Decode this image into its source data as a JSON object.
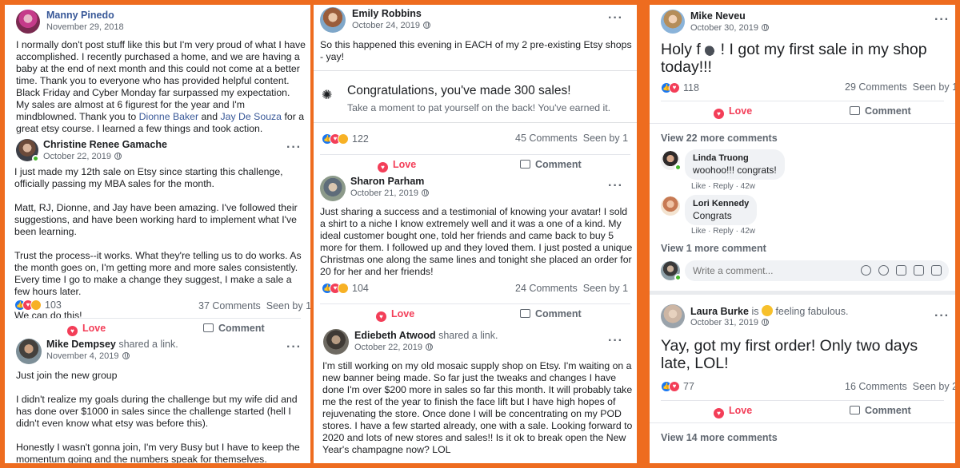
{
  "posts": {
    "manny": {
      "name": "Manny Pinedo",
      "date": "November 29, 2018",
      "text_before_link1": "I normally don't post stuff like this but I'm very proud of what I have accomplished. I recently purchased a home, and we are having a baby at the end of next month and this could not come at a better time. Thank you to everyone who has provided helpful content. Black Friday and Cyber Monday far surpassed my expectation. My sales are almost at 6 figurest for the year and I'm mindblowned. Thank you to ",
      "link1": "Dionne Baker",
      "text_between": " and ",
      "link2": "Jay De Souza",
      "text_after": " for a great etsy course. I learned a few things and took action."
    },
    "christine": {
      "name": "Christine Renee Gamache",
      "date": "October 22, 2019",
      "text": "I just made my 12th sale on Etsy since starting this challenge, officially passing my MBA sales for the month.\n\nMatt, RJ, Dionne, and Jay have been amazing.  I've followed their suggestions, and have been working hard to implement what I've been learning.\n\nTrust the process--it works.  What they're telling us to do works.  As the month goes on, I'm getting more and more sales consistently. Every time I go to make a change they suggest, I make a sale a few hours later.\n\nWe can do this!",
      "reactions": "103",
      "comments": "37 Comments",
      "seen": "Seen by 1",
      "love_label": "Love",
      "comment_label": "Comment"
    },
    "mike_d": {
      "name": "Mike Dempsey",
      "shared": "shared a link.",
      "date": "November 4, 2019",
      "text": "Just join the new group\n\nI didn't realize my goals during the challenge but my wife did and has done over $1000 in sales since the challenge started (hell I didn't even know what etsy was before this).\n\nHonestly I wasn't gonna join, I'm very Busy but I have to keep the momentum going and the numbers speak for themselves.\n\n.Next level folks, that is what I am seeking"
    },
    "emily": {
      "name": "Emily Robbins",
      "date": "October 24, 2019",
      "text": "So this happened this evening in EACH of my 2 pre-existing Etsy shops - yay!",
      "card_title": "Congratulations, you've made 300 sales!",
      "card_sub": "Take a moment to pat yourself on the back! You've earned it.",
      "reactions": "122",
      "comments": "45 Comments",
      "seen": "Seen by 1",
      "love_label": "Love",
      "comment_label": "Comment"
    },
    "sharon": {
      "name": "Sharon Parham",
      "date": "October 21, 2019",
      "text": "Just sharing a success and a testimonial of knowing your avatar! I sold a shirt to a niche I know extremely well and it was a one of a kind. My ideal customer bought one, told her friends and came back to buy 5 more for them. I followed up and they loved them. I just posted a unique Christmas one along the same lines and tonight she placed an order for 20 for her and her friends!",
      "reactions": "104",
      "comments": "24 Comments",
      "seen": "Seen by 1",
      "love_label": "Love",
      "comment_label": "Comment"
    },
    "ediebeth": {
      "name": "Ediebeth Atwood",
      "shared": "shared a link.",
      "date": "October 22, 2019",
      "text": "I'm still working on my old mosaic supply shop on Etsy.  I'm waiting on a new banner being made.  So far just the tweaks and changes I have done I'm over $200 more in sales so far this month.  It will probably take me the rest of the year to finish the face lift but I have high hopes of rejuvenating the store. Once done I will be concentrating on my POD stores. I have a few started already, one with a sale.  Looking forward to 2020 and lots of new stores and sales!!  Is it ok to break open the New Year's champagne now?  LOL"
    },
    "mike_n": {
      "name": "Mike Neveu",
      "date": "October 30, 2019",
      "text_before": "Holy f ",
      "text_after": " ! I got my first sale in my shop today!!!",
      "emoji": "bomb-emoji",
      "reactions": "118",
      "comments": "29 Comments",
      "seen": "Seen by 1",
      "love_label": "Love",
      "comment_label": "Comment",
      "view_more": "View 22 more comments",
      "comment1_name": "Linda Truong",
      "comment1_text": "woohoo!!! congrats!",
      "comment1_meta": "Like · Reply · 42w",
      "comment2_name": "Lori Kennedy",
      "comment2_text": "Congrats",
      "comment2_meta": "Like · Reply · 42w",
      "view_one": "View 1 more comment",
      "reply_placeholder": "Write a comment..."
    },
    "laura": {
      "name": "Laura Burke",
      "feeling_prefix": "is",
      "feeling": "feeling fabulous.",
      "date": "October 31, 2019",
      "text": "Yay, got my first order! Only two days late, LOL!",
      "reactions": "77",
      "comments": "16 Comments",
      "seen": "Seen by 2",
      "love_label": "Love",
      "comment_label": "Comment",
      "view_more": "View 14 more comments"
    }
  },
  "colors": {
    "frame": "#ee6c1f",
    "link": "#385898",
    "love": "#f33e58",
    "like": "#1877f2",
    "muted": "#606770"
  }
}
